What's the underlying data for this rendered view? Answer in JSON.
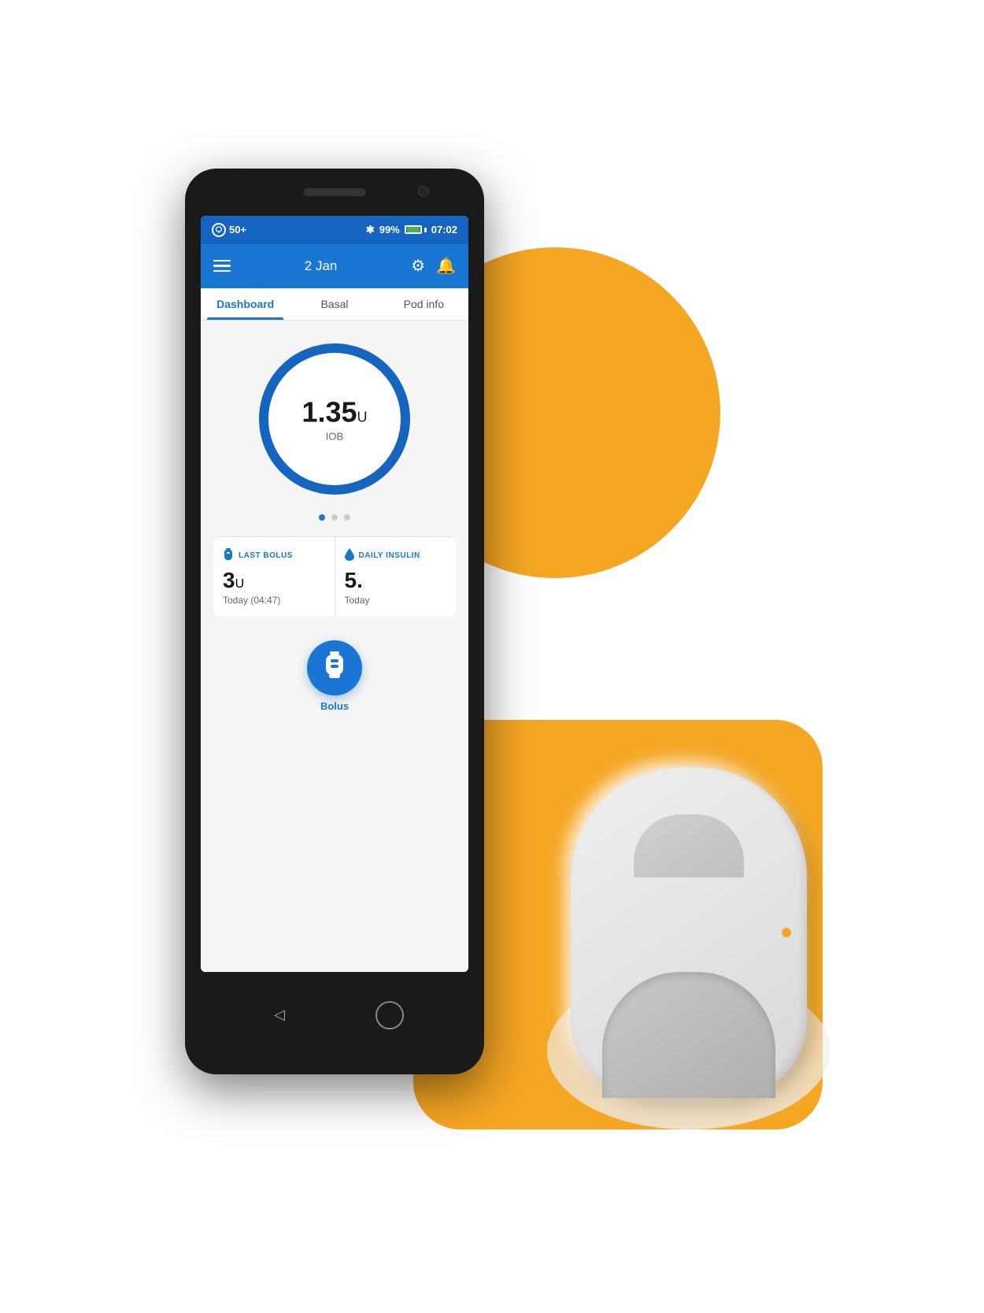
{
  "scene": {
    "background_color": "#ffffff"
  },
  "status_bar": {
    "left_icon": "pod-icon",
    "notification_count": "50+",
    "bluetooth": "✱",
    "battery_percent": "99%",
    "time": "07:02"
  },
  "app_header": {
    "menu_icon": "hamburger",
    "date": "2 Jan",
    "settings_icon": "gear",
    "notification_icon": "bell"
  },
  "tabs": [
    {
      "label": "Dashboard",
      "active": true
    },
    {
      "label": "Basal",
      "active": false
    },
    {
      "label": "Pod info",
      "active": false
    }
  ],
  "iob": {
    "value": "1.35",
    "unit": "U",
    "label": "IOB",
    "circle_color": "#1565C0",
    "circle_bg": "#e8eaf6"
  },
  "dots": [
    {
      "active": true
    },
    {
      "active": false
    },
    {
      "active": false
    }
  ],
  "stats": {
    "last_bolus": {
      "icon": "vial-icon",
      "title": "LAST BOLUS",
      "value": "3",
      "unit": "U",
      "sub": "Today (04:47)"
    },
    "daily_insulin": {
      "icon": "drop-icon",
      "title": "DAILY INSULIN",
      "value": "5.",
      "unit": "",
      "sub": "Today"
    }
  },
  "bolus": {
    "icon": "vial-icon",
    "label": "Bolus"
  },
  "nav": {
    "back_icon": "◁",
    "home_icon": "○"
  }
}
